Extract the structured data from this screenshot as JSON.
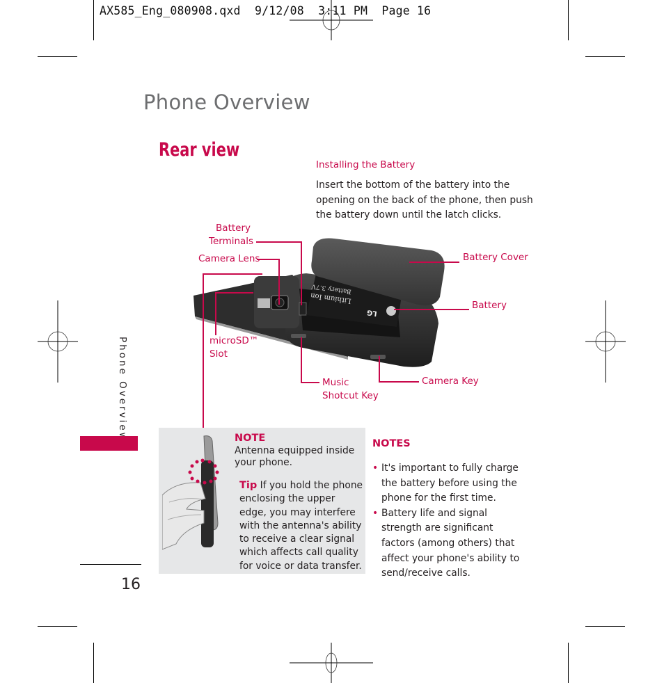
{
  "slug": "AX585_Eng_080908.qxd  9/12/08  3:11 PM  Page 16",
  "page_title": "Phone Overview",
  "section_title": "Rear view",
  "installing": {
    "heading": "Installing the Battery",
    "body": "Insert the bottom of the battery into the opening on the back of the phone, then push the battery down until the latch clicks."
  },
  "callouts": {
    "battery_terminals_1": "Battery",
    "battery_terminals_2": "Terminals",
    "camera_lens": "Camera Lens",
    "microsd_1": "microSD™",
    "microsd_2": "Slot",
    "battery_cover": "Battery Cover",
    "battery": "Battery",
    "music_1": "Music",
    "music_2": "Shotcut Key",
    "camera_key": "Camera Key"
  },
  "battery_label": {
    "line1": "Lithium Ion",
    "line2": "Battery 3.7V",
    "brand": "LG"
  },
  "side_tab": "Phone Overview",
  "page_number": "16",
  "note": {
    "heading": "NOTE",
    "text": "Antenna equipped inside your phone.",
    "tip_label": "Tip",
    "tip_text": " If you hold the phone enclosing the upper edge, you may interfere with the antenna's ability to receive a clear signal which affects call quality for voice or data transfer."
  },
  "notes": {
    "heading": "NOTES",
    "items": [
      "It's important to fully charge the battery before using the phone for the first time.",
      "Battery life and signal strength are significant factors (among others) that affect your phone's ability to send/receive calls."
    ]
  },
  "colors": {
    "accent": "#c8094b",
    "title_gray": "#6d6e70",
    "note_bg": "#e6e7e8"
  }
}
